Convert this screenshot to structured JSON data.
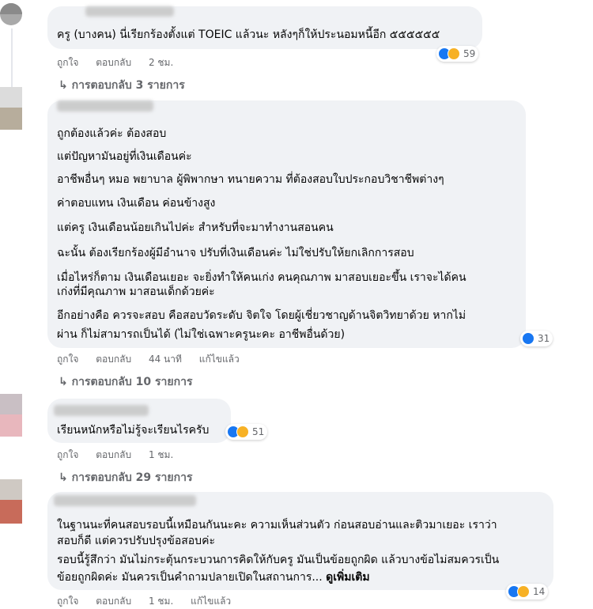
{
  "comments": [
    {
      "lines": [
        "ครู (บางคน) นี่เรียกร้องตั้งแต่ TOEIC แล้วนะ หลังๆก็ให้ประนอมหนี้อีก ๕๕๕๕๕๕"
      ],
      "actions": {
        "like": "ถูกใจ",
        "reply": "ตอบกลับ",
        "time": "2 ชม."
      },
      "reaction_count": "59",
      "replies": "การตอบกลับ 3 รายการ"
    },
    {
      "lines": [
        "ถูกต้องแล้วค่ะ ต้องสอบ",
        "แต่ปัญหามันอยู่ที่เงินเดือนค่ะ",
        "อาชีพอื่นๆ หมอ พยาบาล ผู้พิพากษา ทนายความ ที่ต้องสอบใบประกอบวิชาชีพต่างๆ",
        "ค่าตอบแทน เงินเดือน ค่อนข้างสูง",
        "แต่ครู เงินเดือนน้อยเกินไปค่ะ สำหรับที่จะมาทำงานสอนคน",
        "ฉะนั้น ต้องเรียกร้องผู้มีอำนาจ ปรับที่เงินเดือนค่ะ ไม่ใช่ปรับให้ยกเลิกการสอบ",
        "เมื่อไหร่ก็ตาม เงินเดือนเยอะ จะยิ่งทำให้คนเก่ง คนคุณภาพ มาสอบเยอะขึ้น เราจะได้คน",
        "เก่งที่มีคุณภาพ มาสอนเด็กด้วยค่ะ",
        "อีกอย่างคือ ควรจะสอบ คือสอบวัดระดับ จิตใจ โดยผู้เชี่ยวชาญด้านจิตวิทยาด้วย หากไม่",
        "ผ่าน ก็ไม่สามารถเป็นได้ (ไม่ใช่เฉพาะครูนะคะ อาชีพอื่นด้วย)"
      ],
      "actions": {
        "like": "ถูกใจ",
        "reply": "ตอบกลับ",
        "time": "44 นาที",
        "edited": "แก้ไขแล้ว"
      },
      "reaction_count": "31",
      "replies": "การตอบกลับ 10 รายการ"
    },
    {
      "lines": [
        "เรียนหนักหรือไม่รู้จะเรียนไรครับ"
      ],
      "actions": {
        "like": "ถูกใจ",
        "reply": "ตอบกลับ",
        "time": "1 ชม."
      },
      "reaction_count": "51",
      "replies": "การตอบกลับ 29 รายการ"
    },
    {
      "lines": [
        "ในฐานนะที่คนสอบรอบนี้เหมือนกันนะคะ ความเห็นส่วนตัว ก่อนสอบอ่านและติวมาเยอะ เราว่า",
        "สอบก็ดี แต่ควรปรับปรุงข้อสอบค่ะ",
        "รอบนี้รู้สึกว่า มันไม่กระตุ้นกระบวนการคิดให้กับครู มันเป็นข้อยถูกผิด แล้วบางข้อไม่สมควรเป็น",
        "ข้อยถูกผิดค่ะ มันควรเป็นคำถามปลายเปิดในสถานการ..."
      ],
      "see_more": "ดูเพิ่มเติม",
      "actions": {
        "like": "ถูกใจ",
        "reply": "ตอบกลับ",
        "time": "1 ชม.",
        "edited": "แก้ไขแล้ว"
      },
      "reaction_count": "14"
    }
  ],
  "icons": {
    "reply_arrow": "reply-arrow-icon",
    "like": "like-reaction-icon",
    "haha": "haha-reaction-icon",
    "love": "love-reaction-icon"
  },
  "colors": {
    "bubble": "#f0f2f5",
    "meta": "#65676b",
    "like_blue": "#1877f2"
  }
}
